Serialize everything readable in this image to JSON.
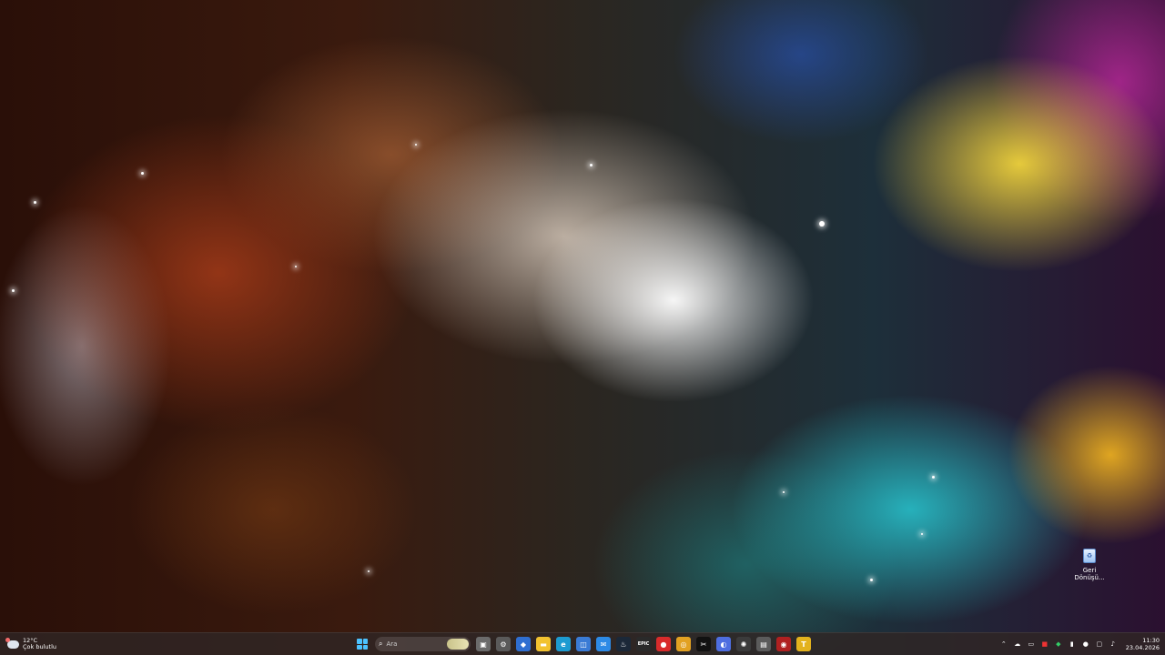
{
  "desktop": {
    "icons": [
      {
        "name": "recycle-bin",
        "label": "Geri Dönüşü..."
      }
    ]
  },
  "taskbar": {
    "weather": {
      "temp": "12°C",
      "condition": "Çok bulutlu"
    },
    "search": {
      "placeholder": "Ara"
    },
    "apps": [
      {
        "name": "task-view-icon",
        "glyph": "▣",
        "color": "#6b6b6b"
      },
      {
        "name": "settings-icon",
        "glyph": "⚙",
        "color": "#5a5a5a"
      },
      {
        "name": "photos-icon",
        "glyph": "◆",
        "color": "#2f6fd1"
      },
      {
        "name": "file-explorer-icon",
        "glyph": "▬",
        "color": "#f2c230"
      },
      {
        "name": "edge-icon",
        "glyph": "e",
        "color": "#1d9bd1"
      },
      {
        "name": "store-icon",
        "glyph": "◫",
        "color": "#3a7bd5"
      },
      {
        "name": "mail-icon",
        "glyph": "✉",
        "color": "#2d8ae6"
      },
      {
        "name": "steam-icon",
        "glyph": "♨",
        "color": "#1b2838"
      },
      {
        "name": "epic-games-icon",
        "glyph": "EPIC",
        "color": "#2a2a2a"
      },
      {
        "name": "record-icon",
        "glyph": "●",
        "color": "#d92b2b"
      },
      {
        "name": "chrome-icon",
        "glyph": "◎",
        "color": "#e2a122"
      },
      {
        "name": "capcut-icon",
        "glyph": "✂",
        "color": "#111111"
      },
      {
        "name": "copilot-icon",
        "glyph": "◐",
        "color": "#4e6ee0"
      },
      {
        "name": "chatgpt-icon",
        "glyph": "✺",
        "color": "#3b3b3b"
      },
      {
        "name": "notepad-icon",
        "glyph": "▤",
        "color": "#5b5b5b"
      },
      {
        "name": "media-icon",
        "glyph": "◉",
        "color": "#b02020"
      },
      {
        "name": "tulpar-icon",
        "glyph": "T",
        "color": "#e3b21d"
      }
    ],
    "tray": {
      "icons": [
        "chevron-up-icon",
        "onedrive-icon",
        "monitor-icon",
        "app-red-icon",
        "shield-icon",
        "battery-icon",
        "mic-icon",
        "display-icon",
        "speaker-icon"
      ],
      "time": "11:30",
      "date": "23.04.2026"
    }
  },
  "colors": {
    "accent": "#4cc2ff",
    "taskbar": "#302624"
  }
}
